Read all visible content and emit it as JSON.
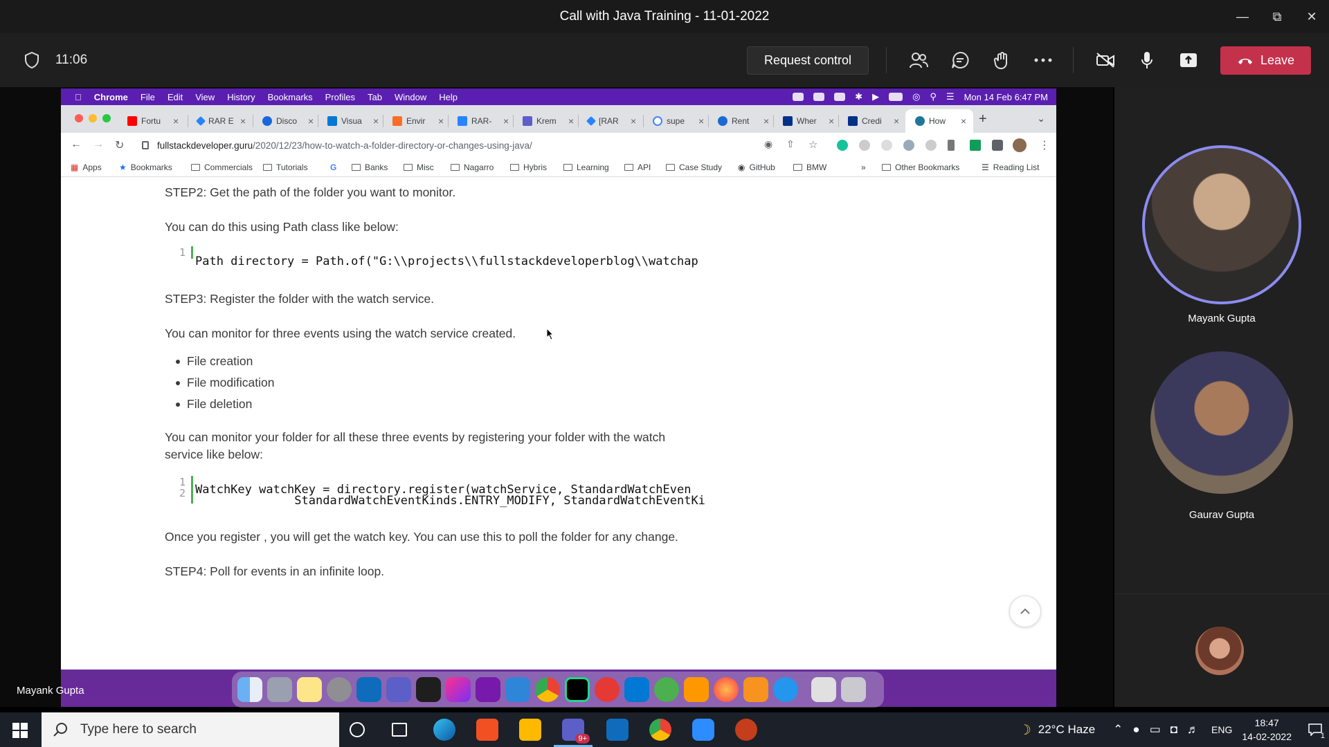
{
  "teams": {
    "window_title": "Call with Java Training - 11-01-2022",
    "timer": "11:06",
    "request_control": "Request control",
    "leave": "Leave",
    "presenter_label": "Mayank Gupta",
    "participants": [
      "Mayank Gupta",
      "Gaurav Gupta"
    ]
  },
  "mac": {
    "menu": [
      "Chrome",
      "File",
      "Edit",
      "View",
      "History",
      "Bookmarks",
      "Profiles",
      "Tab",
      "Window",
      "Help"
    ],
    "datetime": "Mon 14 Feb  6:47 PM"
  },
  "chrome": {
    "tabs": [
      "Fortu",
      "RAR E",
      "Disco",
      "Visua",
      "Envir",
      "RAR-",
      "Krem",
      "[RAR",
      "supe",
      "Rent",
      "Wher",
      "Credi",
      "How"
    ],
    "url_host": "fullstackdeveloper.guru",
    "url_path": "/2020/12/23/how-to-watch-a-folder-directory-or-changes-using-java/",
    "bookmarks": [
      "Apps",
      "Bookmarks",
      "Commercials",
      "Tutorials",
      "G",
      "Banks",
      "Misc",
      "Nagarro",
      "Hybris",
      "Learning",
      "API",
      "Case Study",
      "GitHub",
      "BMW"
    ],
    "bookmarks_overflow": "»",
    "other_bookmarks": "Other Bookmarks",
    "reading_list": "Reading List"
  },
  "article": {
    "step2": "STEP2: Get the path of the folder you want to monitor.",
    "path_intro": "You can do this using Path class like below:",
    "code1_ln": "1",
    "code1": "Path directory = Path.of(\"G:\\\\projects\\\\fullstackdeveloperblog\\\\watchap",
    "step3": "STEP3: Register the folder with the watch service.",
    "events_intro": "You can monitor for three events using the watch service created.",
    "events": [
      "File creation",
      "File modification",
      "File deletion"
    ],
    "register_intro_1": "You can monitor your folder for all these three events by registering your folder with the watch",
    "register_intro_2": "service like below:",
    "code2_ln1": "1",
    "code2_ln2": "2",
    "code2_line1": "WatchKey watchKey = directory.register(watchService, StandardWatchEven",
    "code2_line2": "              StandardWatchEventKinds.ENTRY_MODIFY, StandardWatchEventKi",
    "watchkey_note": "Once you register , you will get the watch key. You can use this to poll the folder for any change.",
    "step4": "STEP4: Poll for events in an infinite loop."
  },
  "windows": {
    "search_placeholder": "Type here to search",
    "teams_badge": "9+",
    "weather": "22°C  Haze",
    "language": "ENG",
    "time": "18:47",
    "date": "14-02-2022",
    "notifications": "1"
  },
  "colors": {
    "leave": "#c4314b",
    "mac_menubar": "#5a1fb0",
    "code_bar": "#4caf50"
  }
}
